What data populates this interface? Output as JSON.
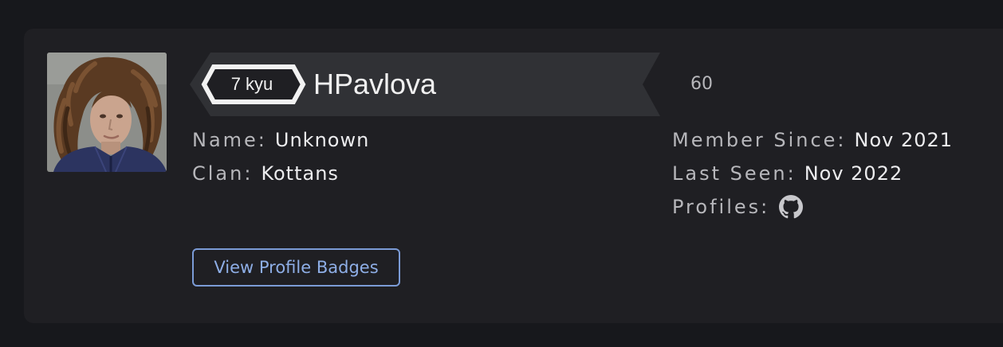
{
  "user": {
    "rank": "7 kyu",
    "username": "HPavlova",
    "honor": "60"
  },
  "details_left": [
    {
      "label": "Name:",
      "value": "Unknown"
    },
    {
      "label": "Clan:",
      "value": "Kottans"
    }
  ],
  "details_right": [
    {
      "label": "Member Since:",
      "value": "Nov 2021"
    },
    {
      "label": "Last Seen:",
      "value": "Nov 2022"
    },
    {
      "label": "Profiles:",
      "icon": "github-icon"
    }
  ],
  "buttons": {
    "view_badges": "View Profile Badges"
  },
  "colors": {
    "background": "#17181c",
    "card": "#1f1f23",
    "banner": "#303135",
    "accent": "#7b9bd6",
    "label": "#b7b7bb",
    "value": "#ececee"
  }
}
